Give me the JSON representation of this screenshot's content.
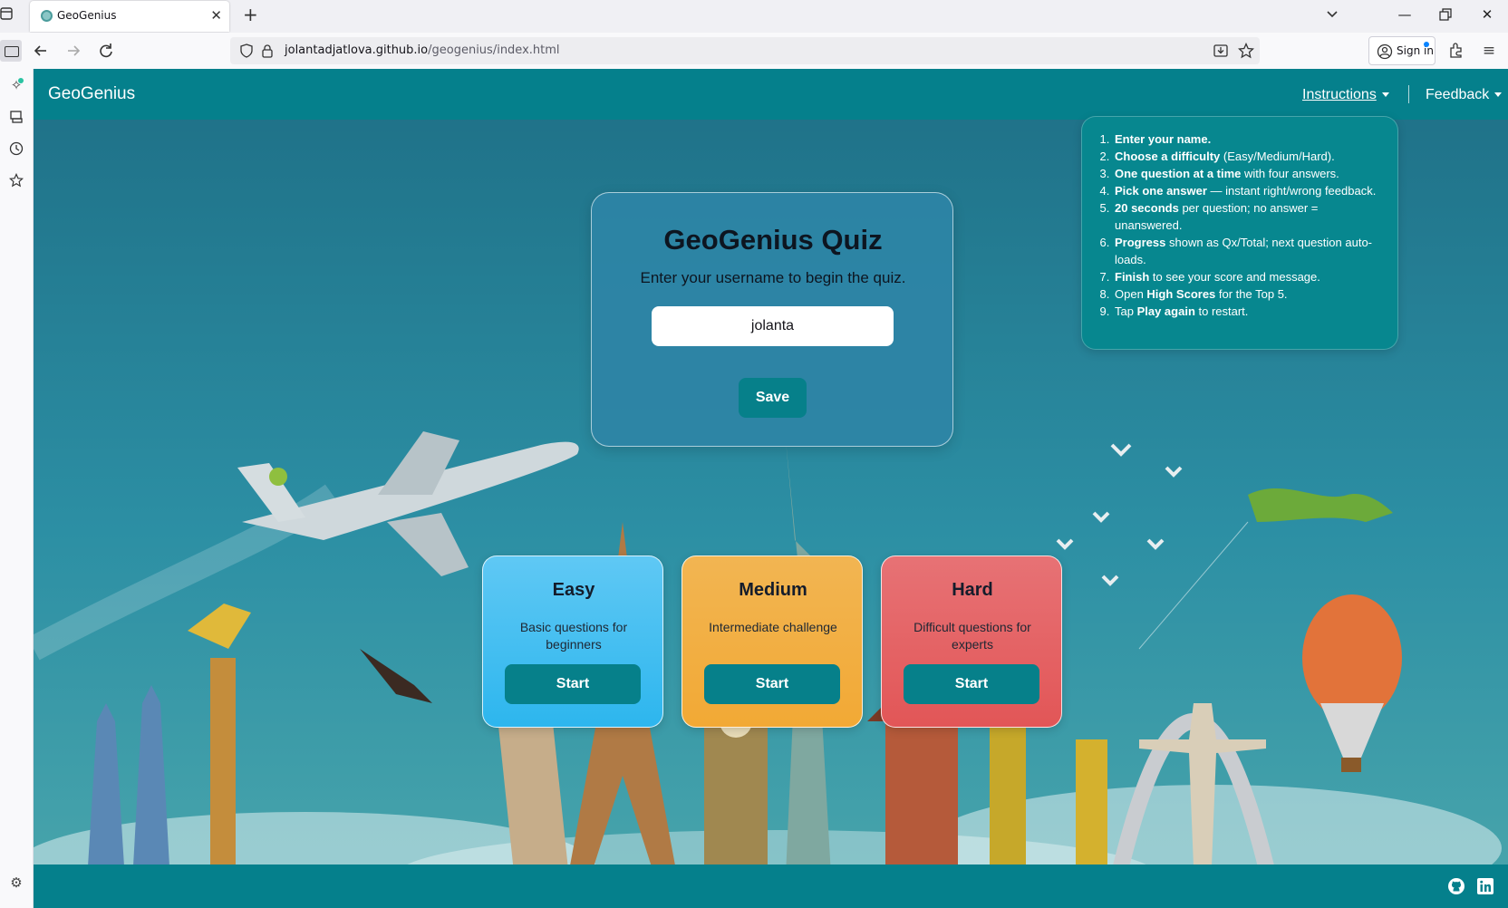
{
  "browser": {
    "tab": {
      "title": "GeoGenius"
    },
    "url": {
      "host": "jolantadjatlova.github.io",
      "path": "/geogenius/index.html"
    },
    "signin_label": "Sign in",
    "accent": "#0a84ff"
  },
  "header": {
    "brand": "GeoGenius",
    "instructions_label": "Instructions",
    "feedback_label": "Feedback",
    "color": "#05808c"
  },
  "instructions": [
    {
      "bold": "Enter your name.",
      "rest": ""
    },
    {
      "bold": "Choose a difficulty",
      "rest": " (Easy/Medium/Hard)."
    },
    {
      "bold": "One question at a time",
      "rest": " with four answers."
    },
    {
      "bold": "Pick one answer",
      "rest": " — instant right/wrong feedback."
    },
    {
      "bold": "20 seconds",
      "rest": " per question; no answer = unanswered."
    },
    {
      "bold": "Progress",
      "rest": " shown as Qx/Total; next question auto-loads."
    },
    {
      "bold": "Finish",
      "rest": " to see your score and message."
    },
    {
      "pre": "Open ",
      "bold": "High Scores",
      "rest": " for the Top 5."
    },
    {
      "pre": "Tap ",
      "bold": "Play again",
      "rest": " to restart."
    }
  ],
  "quiz": {
    "title": "GeoGenius Quiz",
    "subtitle": "Enter your username to begin the quiz.",
    "username_value": "jolanta",
    "save_label": "Save"
  },
  "levels": {
    "easy": {
      "title": "Easy",
      "desc": "Basic questions for beginners",
      "start_label": "Start",
      "color": "#2db6ee"
    },
    "medium": {
      "title": "Medium",
      "desc": "Intermediate challenge",
      "start_label": "Start",
      "color": "#f2a935"
    },
    "hard": {
      "title": "Hard",
      "desc": "Difficult questions for experts",
      "start_label": "Start",
      "color": "#e25657"
    }
  },
  "footer": {
    "icons": [
      "github-icon",
      "linkedin-icon"
    ]
  }
}
